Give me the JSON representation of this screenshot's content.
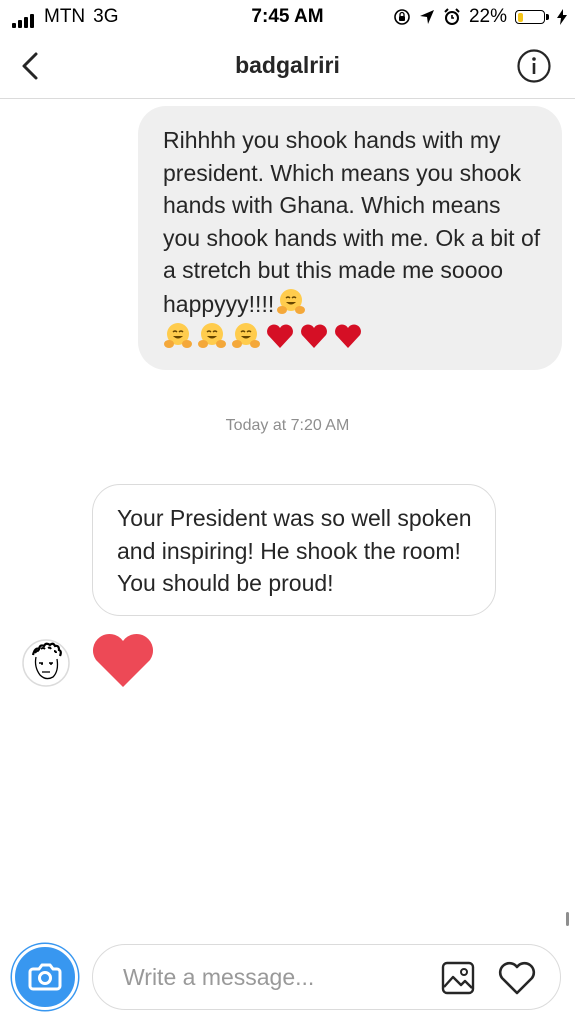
{
  "status_bar": {
    "carrier": "MTN",
    "network": "3G",
    "time": "7:45 AM",
    "battery_percent": "22%",
    "battery_level": 0.22,
    "battery_color": "#f5c518"
  },
  "header": {
    "username": "badgalriri",
    "back_icon": "chevron-left-icon",
    "info_icon": "info-circle-icon"
  },
  "messages": [
    {
      "direction": "sent",
      "text": "Rihhhh you shook hands with my president. Which means you shook hands with Ghana. Which means you shook hands with me. Ok a bit of a stretch but this made me soooo happyyy!!!!",
      "emojis": [
        "hugging-face",
        "hugging-face",
        "hugging-face",
        "hugging-face",
        "red-heart",
        "red-heart",
        "red-heart"
      ]
    },
    {
      "direction": "received",
      "text": "Your President was so well spoken and inspiring! He shook the room! You should be proud!"
    },
    {
      "direction": "received",
      "type": "like",
      "icon": "red-heart-icon"
    }
  ],
  "timestamp": "Today at 7:20 AM",
  "composer": {
    "placeholder": "Write a message...",
    "camera_icon": "camera-icon",
    "gallery_icon": "gallery-icon",
    "like_icon": "heart-outline-icon"
  },
  "colors": {
    "accent": "#3897f0",
    "heart": "#ed4956",
    "bubble_sent": "#efefef",
    "border": "#dbdbdb",
    "muted_text": "#8e8e8e"
  }
}
